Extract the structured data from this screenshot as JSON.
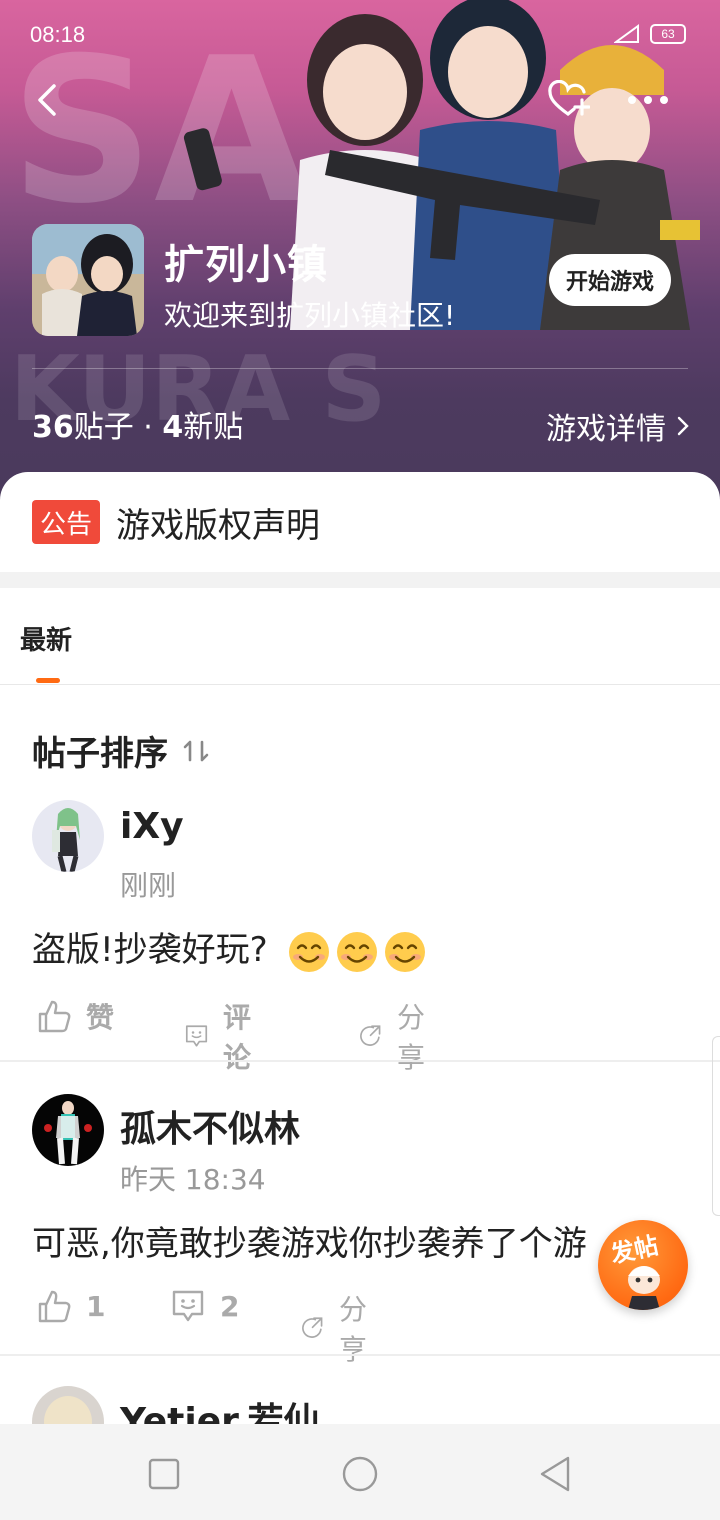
{
  "status_bar": {
    "time": "08:18",
    "battery": "63"
  },
  "colors": {
    "accent": "#ff6a13",
    "notice_red": "#f04a3a",
    "header_top": "#d9659f",
    "header_bottom": "#4a3a5c"
  },
  "header": {
    "back_icon": "chevron-left-icon",
    "favorite_icon": "heart-plus-icon",
    "more_icon": "more-dots-icon",
    "title": "扩列小镇",
    "subtitle": "欢迎来到扩列小镇社区!",
    "start_button": "开始游戏",
    "stats": {
      "posts_count": "36",
      "posts_label": "贴子",
      "separator": " · ",
      "new_count": "4",
      "new_label": "新贴"
    },
    "detail_link": "游戏详情"
  },
  "notice": {
    "badge": "公告",
    "text": "游戏版权声明"
  },
  "tabs": [
    {
      "label": "最新",
      "active": true
    }
  ],
  "sort": {
    "label": "帖子排序",
    "icon": "sort-arrows-icon"
  },
  "posts": [
    {
      "author": "iXy",
      "time": "刚刚",
      "text": "盗版!抄袭好玩?",
      "emoji": [
        "😊",
        "😊",
        "😊"
      ],
      "like": "赞",
      "comment": "评论",
      "share": "分享"
    },
    {
      "author": "孤木不似林",
      "time": "昨天 18:34",
      "text": "可恶,你竟敢抄袭游戏你抄袭养了个游",
      "like": "1",
      "comment": "2",
      "share": "分享"
    },
    {
      "author": "Yetier.若仙"
    }
  ],
  "fab": {
    "label": "发帖"
  },
  "system_nav": {
    "recent_icon": "square-icon",
    "home_icon": "circle-icon",
    "back_icon": "triangle-back-icon"
  }
}
